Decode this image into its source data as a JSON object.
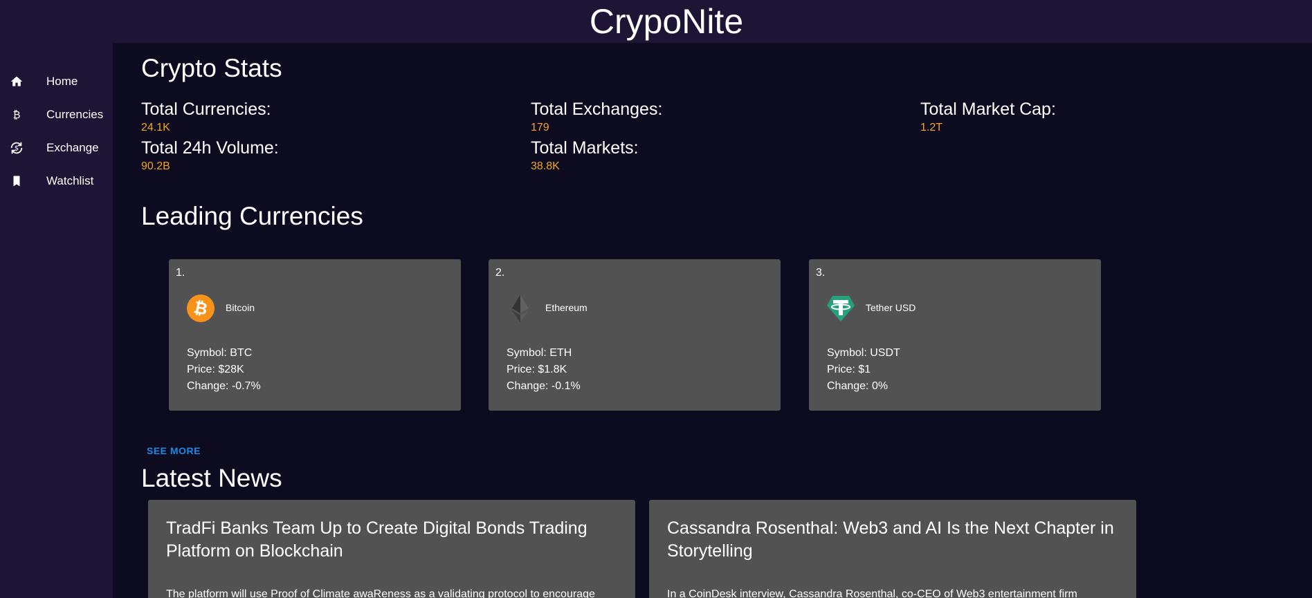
{
  "app": {
    "title": "CrypoNite"
  },
  "sidebar": {
    "items": [
      {
        "label": "Home",
        "icon": "home-icon"
      },
      {
        "label": "Currencies",
        "icon": "bitcoin-icon"
      },
      {
        "label": "Exchange",
        "icon": "exchange-icon"
      },
      {
        "label": "Watchlist",
        "icon": "bookmark-icon"
      }
    ]
  },
  "stats": {
    "heading": "Crypto Stats",
    "total_currencies": {
      "label": "Total Currencies:",
      "value": "24.1K"
    },
    "total_exchanges": {
      "label": "Total Exchanges:",
      "value": "179"
    },
    "total_market_cap": {
      "label": "Total Market Cap:",
      "value": "1.2T"
    },
    "total_24h_volume": {
      "label": "Total 24h Volume:",
      "value": "90.2B"
    },
    "total_markets": {
      "label": "Total Markets:",
      "value": "38.8K"
    },
    "value_color": "#f5a524"
  },
  "leading": {
    "heading": "Leading Currencies",
    "see_more": "SEE MORE",
    "cards": [
      {
        "rank": "1.",
        "name": "Bitcoin",
        "icon": "bitcoin-coin-icon",
        "symbol": "Symbol: BTC",
        "price": "Price: $28K",
        "change": "Change: -0.7%"
      },
      {
        "rank": "2.",
        "name": "Ethereum",
        "icon": "ethereum-coin-icon",
        "symbol": "Symbol: ETH",
        "price": "Price: $1.8K",
        "change": "Change: -0.1%"
      },
      {
        "rank": "3.",
        "name": "Tether USD",
        "icon": "tether-coin-icon",
        "symbol": "Symbol: USDT",
        "price": "Price: $1",
        "change": "Change: 0%"
      }
    ]
  },
  "news": {
    "heading": "Latest News",
    "items": [
      {
        "title": "TradFi Banks Team Up to Create Digital Bonds Trading Platform on Blockchain",
        "description": "The platform will use Proof of Climate awaReness as a validating protocol to encourage"
      },
      {
        "title": "Cassandra Rosenthal: Web3 and AI Is the Next Chapter in Storytelling",
        "description": "In a CoinDesk interview, Cassandra Rosenthal, co-CEO of Web3 entertainment firm"
      }
    ]
  },
  "colors": {
    "sidebar_bg": "#1e1435",
    "main_bg": "#0d0b1f",
    "card_bg": "#525252",
    "link": "#1e88e5",
    "bitcoin": "#f7931a",
    "tether": "#26a17b"
  }
}
